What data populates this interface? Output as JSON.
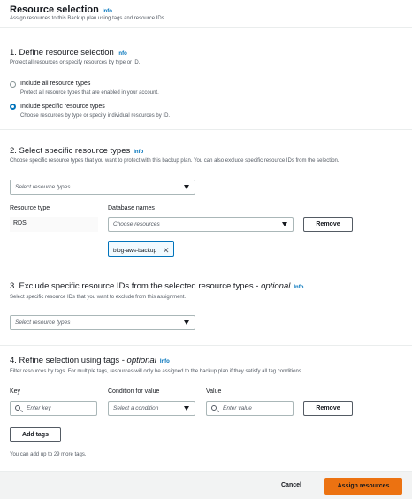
{
  "header": {
    "title": "Resource selection",
    "info": "Info",
    "description": "Assign resources to this Backup plan using tags and resource IDs."
  },
  "section1": {
    "title": "1. Define resource selection",
    "info": "Info",
    "description": "Protect all resources or specify resources by type or ID.",
    "options": [
      {
        "label": "Include all resource types",
        "description": "Protect all resource types that are enabled in your account.",
        "selected": false
      },
      {
        "label": "Include specific resource types",
        "description": "Choose resources by type or specify individual resources by ID.",
        "selected": true
      }
    ]
  },
  "section2": {
    "title": "2. Select specific resource types",
    "info": "Info",
    "description": "Choose specific resource types that you want to protect with this backup plan. You can also exclude specific resource IDs from the selection.",
    "select_placeholder": "Select resource types",
    "resource_type_header": "Resource type",
    "database_names_header": "Database names",
    "row": {
      "resource_type": "RDS",
      "db_placeholder": "Choose resources",
      "remove_label": "Remove"
    },
    "token": "blog-aws-backup"
  },
  "section3": {
    "title_main": "3. Exclude specific resource IDs from the selected resource types - ",
    "title_optional": "optional",
    "info": "Info",
    "description": "Select specific resource IDs that you want to exclude from this assignment.",
    "select_placeholder": "Select resource types"
  },
  "section4": {
    "title_main": "4. Refine selection using tags - ",
    "title_optional": "optional",
    "info": "Info",
    "description": "Filter resources by tags. For multiple tags, resources will only be assigned to the backup plan if they satisfy all tag conditions.",
    "key_label": "Key",
    "condition_label": "Condition for value",
    "value_label": "Value",
    "key_placeholder": "Enter key",
    "condition_placeholder": "Select a condition",
    "value_placeholder": "Enter value",
    "remove_label": "Remove",
    "add_tags_label": "Add tags",
    "footer_note": "You can add up to 29 more tags."
  },
  "footer": {
    "cancel_label": "Cancel",
    "assign_label": "Assign resources"
  },
  "colors": {
    "accent": "#ec7211",
    "link": "#0073bb",
    "border": "#aab7b8",
    "background": "#ffffff",
    "footer_bg": "#f2f3f3"
  }
}
